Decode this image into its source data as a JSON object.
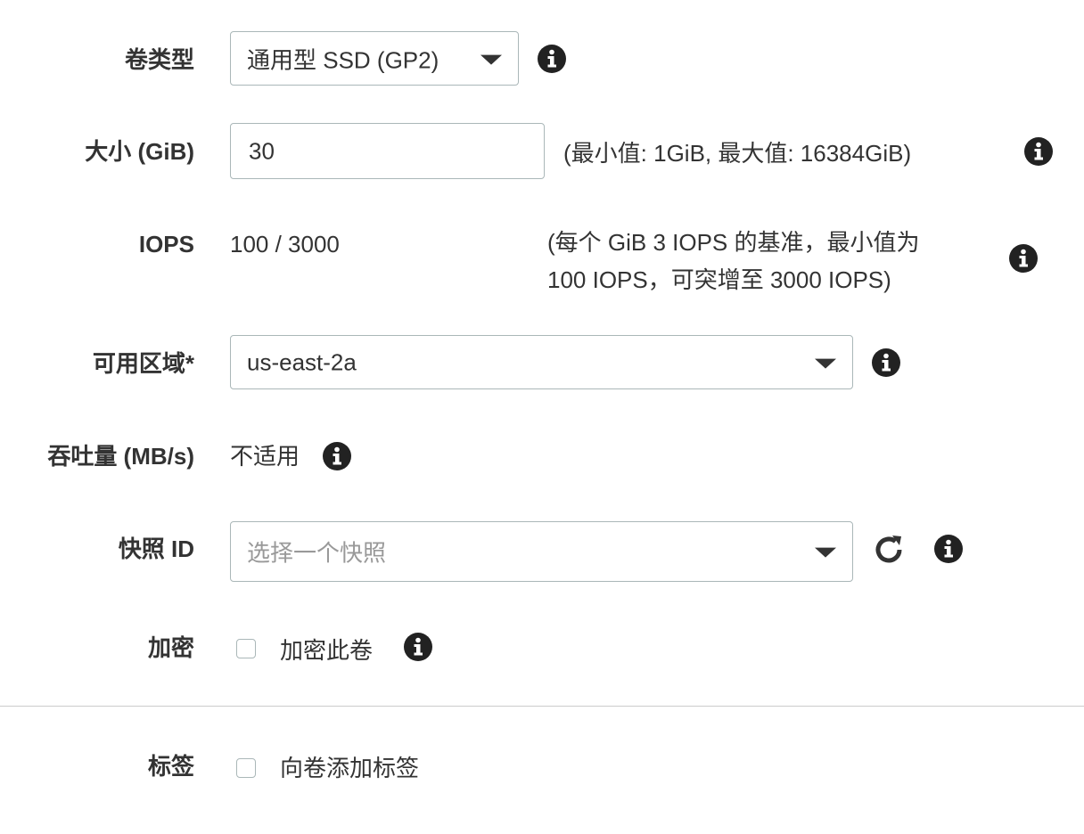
{
  "volume_type": {
    "label": "卷类型",
    "value": "通用型 SSD (GP2)"
  },
  "size": {
    "label": "大小 (GiB)",
    "value": "30",
    "hint": "(最小值: 1GiB, 最大值: 16384GiB)"
  },
  "iops": {
    "label": "IOPS",
    "value": "100 / 3000",
    "hint_line1": "(每个 GiB 3 IOPS 的基准，最小值为",
    "hint_line2": "100 IOPS，可突增至 3000 IOPS)"
  },
  "availability_zone": {
    "label": "可用区域*",
    "value": "us-east-2a"
  },
  "throughput": {
    "label": "吞吐量 (MB/s)",
    "value": "不适用"
  },
  "snapshot": {
    "label": "快照 ID",
    "placeholder": "选择一个快照"
  },
  "encryption": {
    "label": "加密",
    "checkbox_label": "加密此卷",
    "checked": false
  },
  "tags": {
    "label": "标签",
    "checkbox_label": "向卷添加标签",
    "checked": false
  },
  "icons": {
    "info": "info-icon",
    "refresh": "refresh-icon",
    "dropdown": "caret-down-icon"
  },
  "colors": {
    "text": "#333333",
    "border": "#aab7b8",
    "placeholder": "#999999",
    "divider": "#cccccc"
  }
}
